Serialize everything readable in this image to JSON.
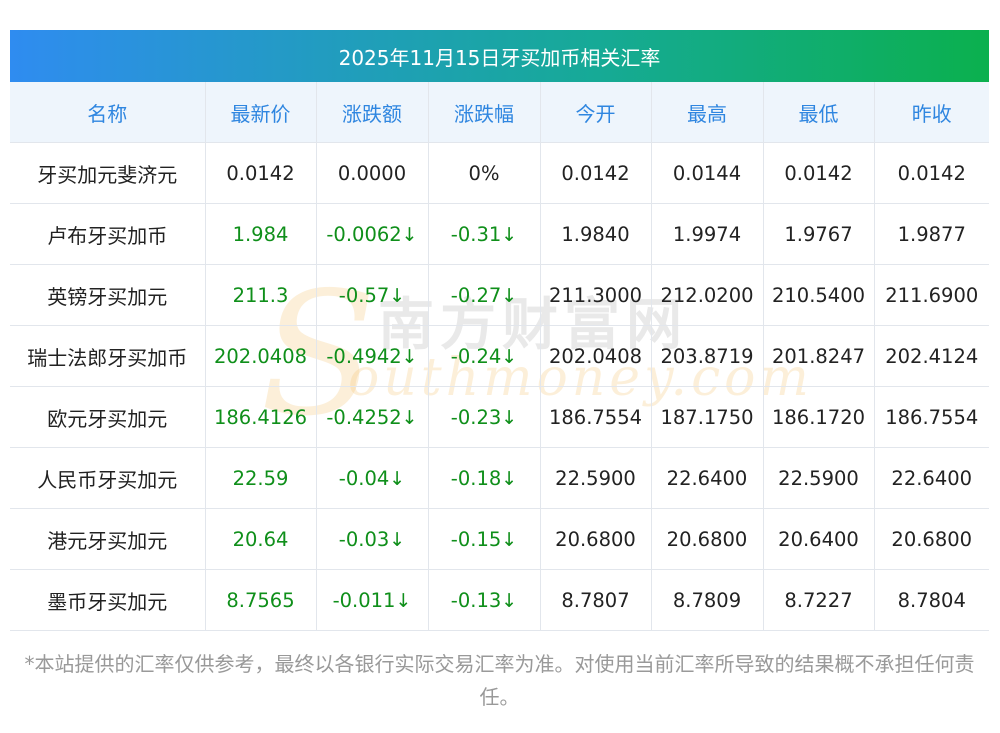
{
  "title": "2025年11月15日牙买加币相关汇率",
  "headers": [
    "名称",
    "最新价",
    "涨跌额",
    "涨跌幅",
    "今开",
    "最高",
    "最低",
    "昨收"
  ],
  "rows": [
    {
      "name": "牙买加元斐济元",
      "latest": "0.0142",
      "change": "0.0000",
      "change_arrow": "",
      "pct": "0%",
      "pct_arrow": "",
      "open": "0.0142",
      "high": "0.0144",
      "low": "0.0142",
      "prev": "0.0142",
      "down": false
    },
    {
      "name": "卢布牙买加币",
      "latest": "1.984",
      "change": "-0.0062",
      "change_arrow": "↓",
      "pct": "-0.31",
      "pct_arrow": "↓",
      "open": "1.9840",
      "high": "1.9974",
      "low": "1.9767",
      "prev": "1.9877",
      "down": true
    },
    {
      "name": "英镑牙买加元",
      "latest": "211.3",
      "change": "-0.57",
      "change_arrow": "↓",
      "pct": "-0.27",
      "pct_arrow": "↓",
      "open": "211.3000",
      "high": "212.0200",
      "low": "210.5400",
      "prev": "211.6900",
      "down": true
    },
    {
      "name": "瑞士法郎牙买加币",
      "latest": "202.0408",
      "change": "-0.4942",
      "change_arrow": "↓",
      "pct": "-0.24",
      "pct_arrow": "↓",
      "open": "202.0408",
      "high": "203.8719",
      "low": "201.8247",
      "prev": "202.4124",
      "down": true
    },
    {
      "name": "欧元牙买加元",
      "latest": "186.4126",
      "change": "-0.4252",
      "change_arrow": "↓",
      "pct": "-0.23",
      "pct_arrow": "↓",
      "open": "186.7554",
      "high": "187.1750",
      "low": "186.1720",
      "prev": "186.7554",
      "down": true
    },
    {
      "name": "人民币牙买加元",
      "latest": "22.59",
      "change": "-0.04",
      "change_arrow": "↓",
      "pct": "-0.18",
      "pct_arrow": "↓",
      "open": "22.5900",
      "high": "22.6400",
      "low": "22.5900",
      "prev": "22.6400",
      "down": true
    },
    {
      "name": "港元牙买加元",
      "latest": "20.64",
      "change": "-0.03",
      "change_arrow": "↓",
      "pct": "-0.15",
      "pct_arrow": "↓",
      "open": "20.6800",
      "high": "20.6800",
      "low": "20.6400",
      "prev": "20.6800",
      "down": true
    },
    {
      "name": "墨币牙买加元",
      "latest": "8.7565",
      "change": "-0.011",
      "change_arrow": "↓",
      "pct": "-0.13",
      "pct_arrow": "↓",
      "open": "8.7807",
      "high": "8.7809",
      "low": "8.7227",
      "prev": "8.7804",
      "down": true
    }
  ],
  "watermark": {
    "cn": "南方财富网",
    "en": "outhmoney.com",
    "logo_letter": "S"
  },
  "footnote": "*本站提供的汇率仅供参考，最终以各银行实际交易汇率为准。对使用当前汇率所导致的结果概不承担任何责任。",
  "colors": {
    "title_gradient_start": "#2f8cf0",
    "title_gradient_end": "#0bb04e",
    "header_bg": "#eef5fc",
    "header_text": "#2f86e0",
    "down_green": "#0f8f1a",
    "footnote_gray": "#999999"
  }
}
